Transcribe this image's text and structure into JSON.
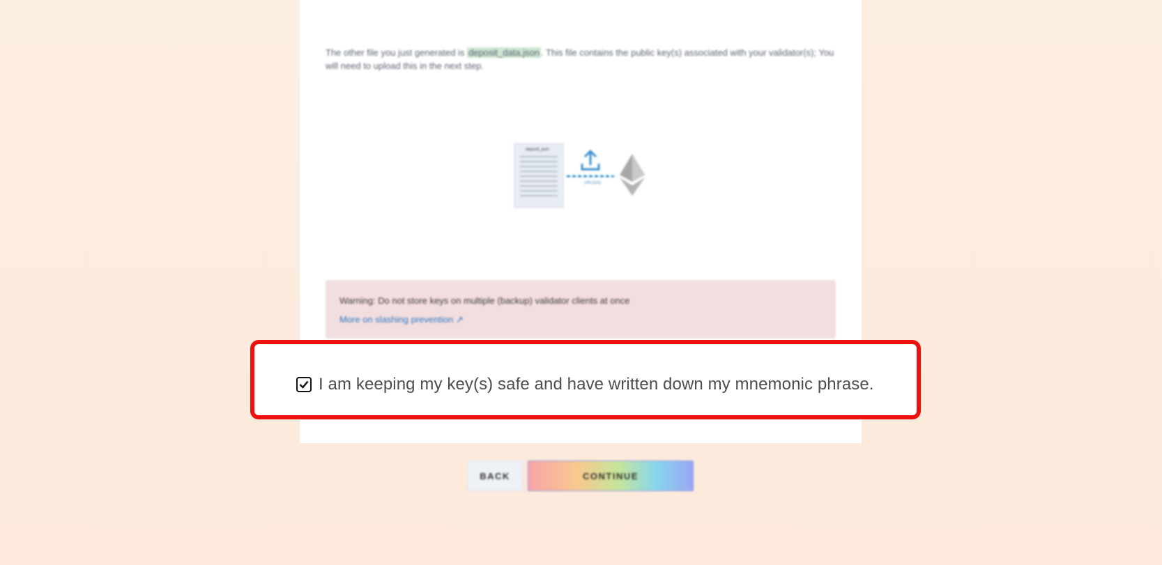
{
  "info": {
    "text_before": "The other file you just generated is ",
    "filename": "deposit_data.json",
    "text_after": ". This file contains the public key(s) associated with your validator(s); You will need to upload this in the next step."
  },
  "illustration": {
    "doc_title": "deposit_json",
    "upload_label": "UPLOAD",
    "icons": [
      "file-icon",
      "upload-icon",
      "ethereum-icon"
    ]
  },
  "warning": {
    "text": "Warning: Do not store keys on multiple (backup) validator clients at once",
    "link": "More on slashing prevention ↗"
  },
  "confirm": {
    "label": "I am keeping my key(s) safe and have written down my mnemonic phrase.",
    "checked": true
  },
  "buttons": {
    "back": "BACK",
    "continue": "CONTINUE"
  },
  "colors": {
    "highlight_border": "#ee1111",
    "warning_bg": "#f3dedf",
    "link": "#2a78c4"
  }
}
